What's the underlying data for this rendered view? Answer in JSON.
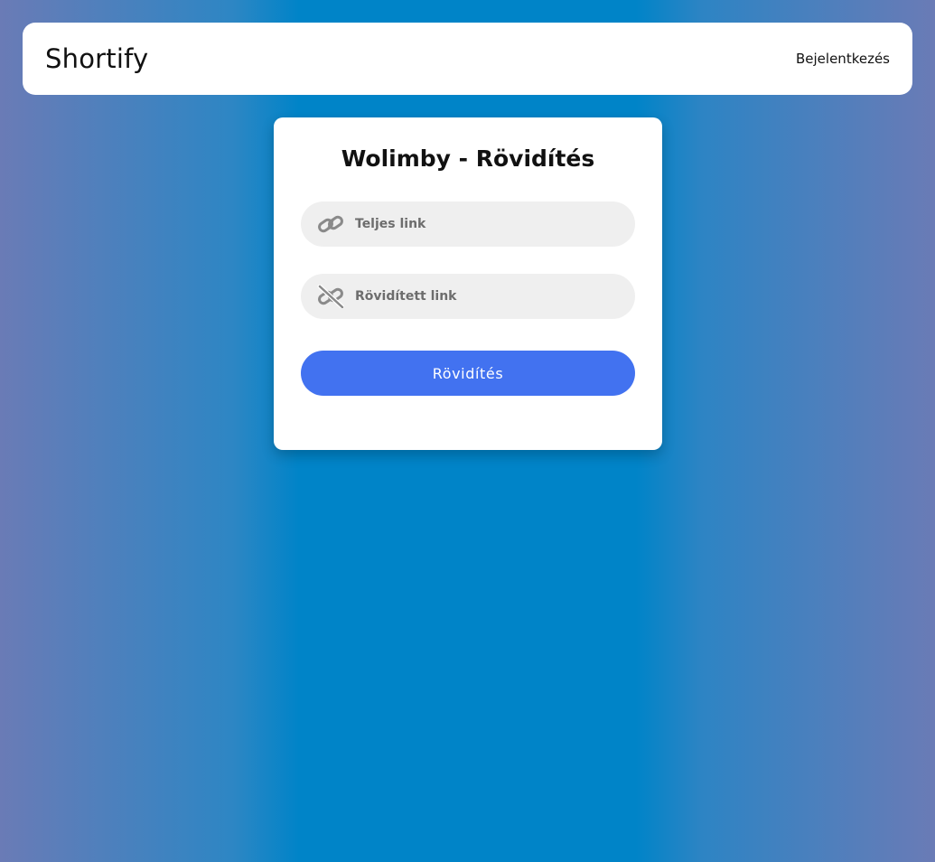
{
  "navbar": {
    "brand": "Shortify",
    "login_label": "Bejelentkezés"
  },
  "form": {
    "title": "Wolimby - Rövidítés",
    "full_link": {
      "placeholder": "Teljes link",
      "value": "",
      "icon": "link-icon"
    },
    "short_link": {
      "placeholder": "Rövidített link",
      "value": "",
      "icon": "link-slash-icon"
    },
    "submit_label": "Rövidítés"
  },
  "colors": {
    "background_center": "#0084c8",
    "background_edge": "#6a7bb6",
    "button": "#4272f0",
    "field": "#efefef",
    "icon": "#8a8a8a"
  }
}
